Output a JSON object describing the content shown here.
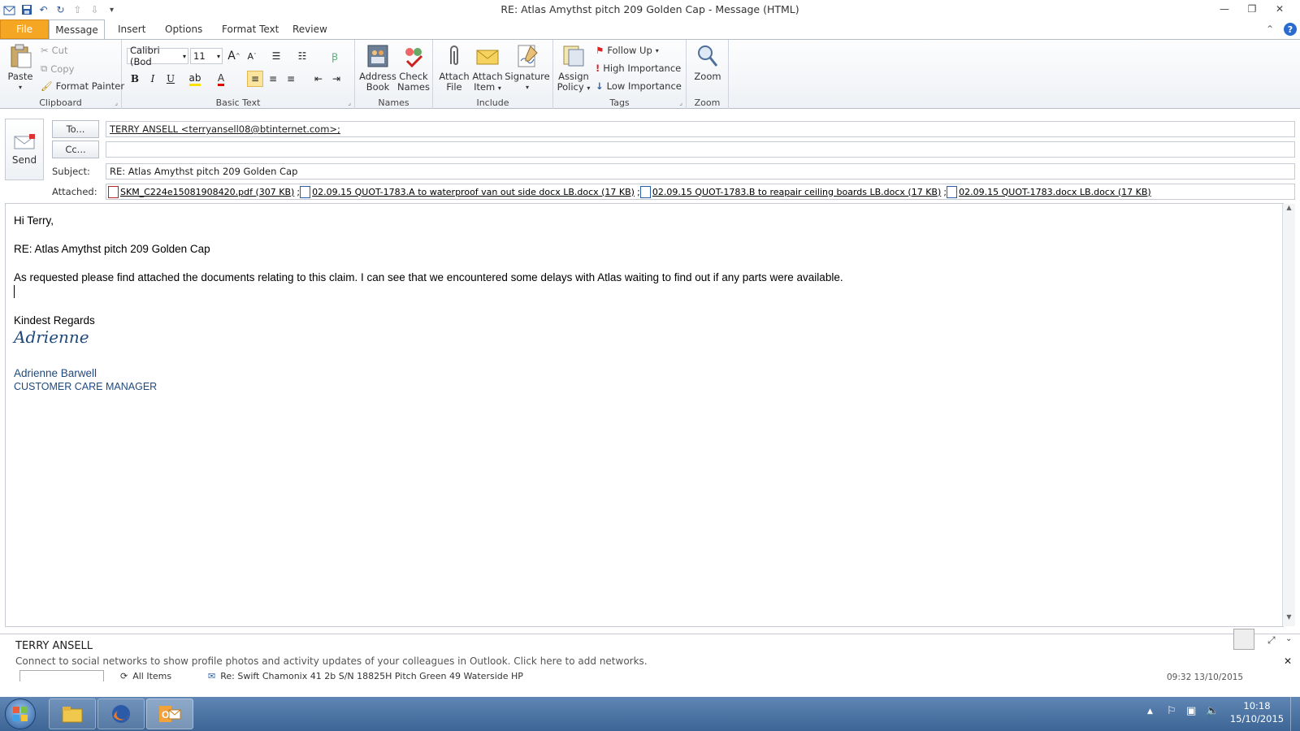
{
  "window": {
    "title": "RE: Atlas Amythst pitch 209 Golden Cap  -  Message (HTML)"
  },
  "tabs": [
    "File",
    "Message",
    "Insert",
    "Options",
    "Format Text",
    "Review"
  ],
  "ribbon": {
    "clipboard": {
      "label": "Clipboard",
      "paste": "Paste",
      "cut": "Cut",
      "copy": "Copy",
      "format_painter": "Format Painter"
    },
    "basic_text": {
      "label": "Basic Text",
      "font": "Calibri (Bod",
      "size": "11"
    },
    "names": {
      "label": "Names",
      "address_book": [
        "Address",
        "Book"
      ],
      "check_names": [
        "Check",
        "Names"
      ]
    },
    "include": {
      "label": "Include",
      "attach_file": [
        "Attach",
        "File"
      ],
      "attach_item": [
        "Attach",
        "Item"
      ],
      "signature": "Signature"
    },
    "tags": {
      "label": "Tags",
      "assign_policy": [
        "Assign",
        "Policy"
      ],
      "follow_up": "Follow Up",
      "high_importance": "High Importance",
      "low_importance": "Low Importance"
    },
    "zoom": {
      "label": "Zoom",
      "zoom": "Zoom"
    }
  },
  "compose": {
    "send": "Send",
    "to_button": "To...",
    "cc_button": "Cc...",
    "subject_label": "Subject:",
    "attached_label": "Attached:",
    "to_value": "TERRY ANSELL <terryansell08@btinternet.com>;",
    "cc_value": "",
    "subject_value": "RE: Atlas Amythst pitch 209 Golden Cap",
    "attachments": [
      {
        "name": "SKM_C224e15081908420.pdf (307 KB)",
        "type": "pdf",
        "sep": ";"
      },
      {
        "name": "02.09.15 QUOT-1783.A to waterproof van out side docx LB.docx (17 KB)",
        "type": "word",
        "sep": ";"
      },
      {
        "name": "02.09.15 QUOT-1783.B to reapair ceiling boards LB.docx (17 KB)",
        "type": "word",
        "sep": ";"
      },
      {
        "name": "02.09.15 QUOT-1783.docx LB.docx (17 KB)",
        "type": "word",
        "sep": ""
      }
    ]
  },
  "body": {
    "greeting": "Hi Terry,",
    "re_line": "RE: Atlas Amythst pitch 209 Golden Cap",
    "paragraph": "As requested please find attached the documents relating to this claim.  I can see that we encountered some delays with Atlas waiting to find out if any parts were available.",
    "closing": "Kindest Regards",
    "signature_script": "Adrienne",
    "sig_name": "Adrienne Barwell",
    "sig_title": "CUSTOMER CARE MANAGER"
  },
  "people_pane": {
    "contact": "TERRY ANSELL",
    "social_prompt": "Connect to social networks to show profile photos and activity updates of your colleagues in Outlook. Click here to add networks.",
    "all_items": "All Items",
    "item_subject": "Re: Swift Chamonix 41 2b S/N 18825H Pitch Green 49 Waterside HP",
    "item_time": "09:32 13/10/2015"
  },
  "taskbar": {
    "time": "10:18",
    "date": "15/10/2015"
  }
}
